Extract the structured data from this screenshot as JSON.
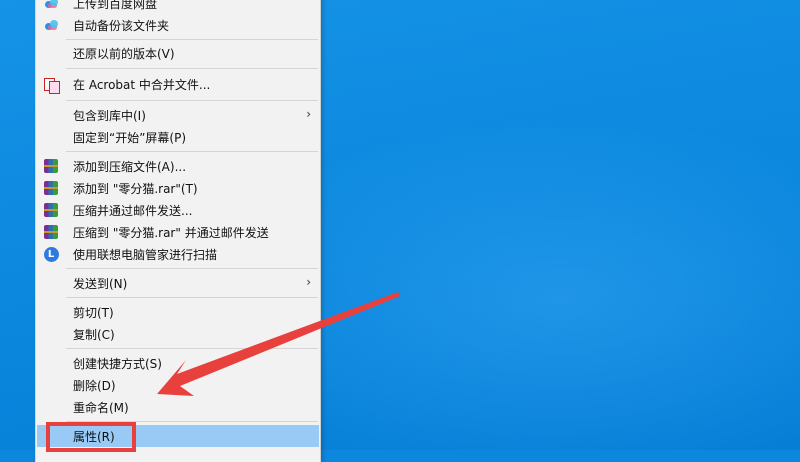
{
  "menu": {
    "items": [
      {
        "label": "上传到百度网盘",
        "icon": "baidu-netdisk-icon",
        "arrow": ""
      },
      {
        "label": "自动备份该文件夹",
        "icon": "baidu-netdisk-icon",
        "arrow": ""
      },
      {
        "label": "还原以前的版本(V)",
        "icon": "",
        "arrow": ""
      },
      {
        "label": "在 Acrobat 中合并文件...",
        "icon": "acrobat-icon",
        "arrow": ""
      },
      {
        "label": "包含到库中(I)",
        "icon": "",
        "arrow": "›"
      },
      {
        "label": "固定到“开始”屏幕(P)",
        "icon": "",
        "arrow": ""
      },
      {
        "label": "添加到压缩文件(A)...",
        "icon": "winrar-icon",
        "arrow": ""
      },
      {
        "label": "添加到 \"零分猫.rar\"(T)",
        "icon": "winrar-icon",
        "arrow": ""
      },
      {
        "label": "压缩并通过邮件发送...",
        "icon": "winrar-icon",
        "arrow": ""
      },
      {
        "label": "压缩到 \"零分猫.rar\" 并通过邮件发送",
        "icon": "winrar-icon",
        "arrow": ""
      },
      {
        "label": "使用联想电脑管家进行扫描",
        "icon": "lenovo-icon",
        "arrow": ""
      },
      {
        "label": "发送到(N)",
        "icon": "",
        "arrow": "›"
      },
      {
        "label": "剪切(T)",
        "icon": "",
        "arrow": ""
      },
      {
        "label": "复制(C)",
        "icon": "",
        "arrow": ""
      },
      {
        "label": "创建快捷方式(S)",
        "icon": "",
        "arrow": ""
      },
      {
        "label": "删除(D)",
        "icon": "",
        "arrow": ""
      },
      {
        "label": "重命名(M)",
        "icon": "",
        "arrow": ""
      },
      {
        "label": "属性(R)",
        "icon": "",
        "arrow": ""
      }
    ],
    "lenovo_glyph": "L"
  },
  "annotation": {
    "callout_color": "#e8403d",
    "highlight_color": "#99c9f5"
  }
}
